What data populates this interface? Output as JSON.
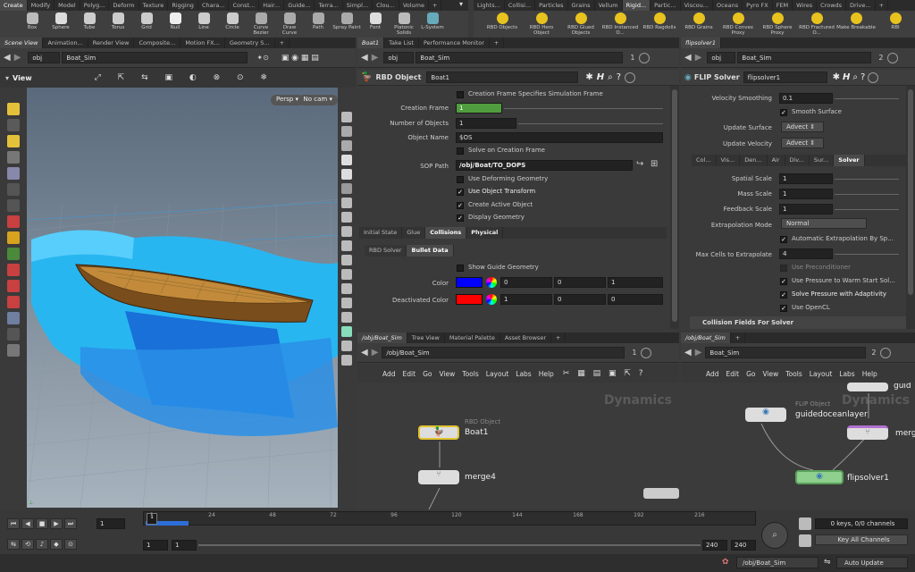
{
  "shelf": {
    "tabs_left": [
      "Create",
      "Modify",
      "Model",
      "Polyg...",
      "Deform",
      "Texture",
      "Rigging",
      "Chara...",
      "Const...",
      "Hair...",
      "Guide...",
      "Terra...",
      "Simpl...",
      "Clou...",
      "Volume",
      "+"
    ],
    "tools_left": [
      {
        "label": "Box",
        "icon": "box-icon"
      },
      {
        "label": "Sphere",
        "icon": "sphere-icon"
      },
      {
        "label": "Tube",
        "icon": "tube-icon"
      },
      {
        "label": "Torus",
        "icon": "torus-icon"
      },
      {
        "label": "Grid",
        "icon": "grid-icon"
      },
      {
        "label": "Null",
        "icon": "null-icon"
      },
      {
        "label": "Line",
        "icon": "line-icon"
      },
      {
        "label": "Circle",
        "icon": "circle-icon"
      },
      {
        "label": "Curve Bezier",
        "icon": "curve-bezier-icon"
      },
      {
        "label": "Draw Curve",
        "icon": "draw-curve-icon"
      },
      {
        "label": "Path",
        "icon": "path-icon"
      },
      {
        "label": "Spray Paint",
        "icon": "spray-paint-icon"
      },
      {
        "label": "Font",
        "icon": "font-icon"
      },
      {
        "label": "Platonic Solids",
        "icon": "platonic-icon"
      },
      {
        "label": "L-System",
        "icon": "lsystem-icon"
      }
    ],
    "tabs_right": [
      "Lights...",
      "Collisi...",
      "Particles",
      "Grains",
      "Vellum",
      "Rigid...",
      "Partic...",
      "Viscou...",
      "Oceans",
      "Pyro FX",
      "FEM",
      "Wires",
      "Crowds",
      "Drive...",
      "+"
    ],
    "tools_right": [
      {
        "label": "RBD Objects",
        "icon": "rbd-objects-icon"
      },
      {
        "label": "RBD Hero Object",
        "icon": "rbd-hero-icon"
      },
      {
        "label": "RBD Glued Objects",
        "icon": "rbd-glued-icon"
      },
      {
        "label": "RBD Instanced O...",
        "icon": "rbd-instanced-icon"
      },
      {
        "label": "RBD Ragdolls",
        "icon": "rbd-ragdolls-icon"
      },
      {
        "label": "RBD Grains",
        "icon": "rbd-grains-icon"
      },
      {
        "label": "RBD Convex Proxy",
        "icon": "rbd-convex-icon"
      },
      {
        "label": "RBD Sphere Proxy",
        "icon": "rbd-sphere-icon"
      },
      {
        "label": "RBD Fractured O...",
        "icon": "rbd-fractured-icon"
      },
      {
        "label": "Make Breakable",
        "icon": "make-breakable-icon"
      },
      {
        "label": "RBI",
        "icon": "rbi-icon"
      }
    ]
  },
  "viewport": {
    "tabs": [
      "Scene View",
      "Animation...",
      "Render View",
      "Composite...",
      "Motion FX...",
      "Geometry S...",
      "+"
    ],
    "path_obj": "obj",
    "path_node": "Boat_Sim",
    "title": "View",
    "persp": "Persp",
    "cam": "No cam"
  },
  "parm1": {
    "tabs": [
      "Boat1",
      "Take List",
      "Performance Monitor",
      "+"
    ],
    "path_obj": "obj",
    "path_node": "Boat_Sim",
    "pin": "1",
    "node_type": "RBD Object",
    "node_name": "Boat1",
    "creation_frame_specifies": "Creation Frame Specifies Simulation Frame",
    "creation_frame_label": "Creation Frame",
    "creation_frame": "1",
    "num_objects_label": "Number of Objects",
    "num_objects": "1",
    "object_name_label": "Object Name",
    "object_name": "$OS",
    "solve_on_creation": "Solve on Creation Frame",
    "sop_path_label": "SOP Path",
    "sop_path": "/obj/Boat/TO_DOPS",
    "use_deforming": "Use Deforming Geometry",
    "use_object_transform": "Use Object Transform",
    "create_active": "Create Active Object",
    "display_geometry": "Display Geometry",
    "main_tabs": [
      "Initial State",
      "Glue",
      "Collisions",
      "Physical"
    ],
    "sub_tabs": [
      "RBD Solver",
      "Bullet Data"
    ],
    "show_guide": "Show Guide Geometry",
    "color_label": "Color",
    "color": [
      "0",
      "0",
      "1"
    ],
    "deact_label": "Deactivated Color",
    "deact": [
      "1",
      "0",
      "0"
    ],
    "color_swatch": "#0000ff",
    "deact_swatch": "#ff0000"
  },
  "parm2": {
    "tab": "flipsolver1",
    "path_obj": "obj",
    "path_node": "Boat_Sim",
    "pin": "2",
    "node_type": "FLIP Solver",
    "node_name": "flipsolver1",
    "vel_smooth_label": "Velocity Smoothing",
    "vel_smooth": "0.1",
    "smooth_surface": "Smooth Surface",
    "update_surface_label": "Update Surface",
    "update_surface": "Advect",
    "update_velocity_label": "Update Velocity",
    "update_velocity": "Advect",
    "tabs": [
      "Col...",
      "Vis...",
      "Den...",
      "Air",
      "Div...",
      "Sur...",
      "Solver"
    ],
    "spatial_label": "Spatial Scale",
    "spatial": "1",
    "mass_label": "Mass Scale",
    "mass": "1",
    "feedback_label": "Feedback Scale",
    "feedback": "1",
    "extrap_mode_label": "Extrapolation Mode",
    "extrap_mode": "Normal",
    "auto_extrap": "Automatic Extrapolation By Sp...",
    "max_cells_label": "Max Cells to Extrapolate",
    "max_cells": "4",
    "use_precond": "Use Preconditioner",
    "use_pressure": "Use Pressure to Warm Start Sol...",
    "solve_pressure": "Solve Pressure with Adaptivity",
    "use_opencl": "Use OpenCL",
    "collision_fields": "Collision Fields For Solver"
  },
  "net1": {
    "tabs": [
      "/obj/Boat_Sim",
      "Tree View",
      "Material Palette",
      "Asset Browser",
      "+"
    ],
    "path": "/obj/Boat_Sim",
    "menu": [
      "Add",
      "Edit",
      "Go",
      "View",
      "Tools",
      "Layout",
      "Labs",
      "Help"
    ],
    "context": "Dynamics",
    "node1_type": "RBD Object",
    "node1_name": "Boat1",
    "node2_name": "merge4"
  },
  "net2": {
    "tab": "/obj/Boat_Sim",
    "path": "Boat_Sim",
    "menu": [
      "Add",
      "Edit",
      "Go",
      "View",
      "Tools",
      "Layout",
      "Labs",
      "Help"
    ],
    "context": "Dynamics",
    "node1_type": "FLIP Object",
    "node1_name": "guidedoceanlayer",
    "node2_name": "merg",
    "node3_name": "flipsolver1",
    "node4_name": "guid"
  },
  "timeline": {
    "ticks": [
      "1",
      "24",
      "48",
      "72",
      "96",
      "120",
      "144",
      "168",
      "192",
      "216"
    ],
    "frame": "1",
    "start": "1",
    "start2": "1",
    "end": "240",
    "end2": "240",
    "keys": "0 keys, 0/0 channels",
    "key_all": "Key All Channels"
  },
  "status": {
    "path": "/obj/Boat_Sim",
    "update": "Auto Update"
  }
}
